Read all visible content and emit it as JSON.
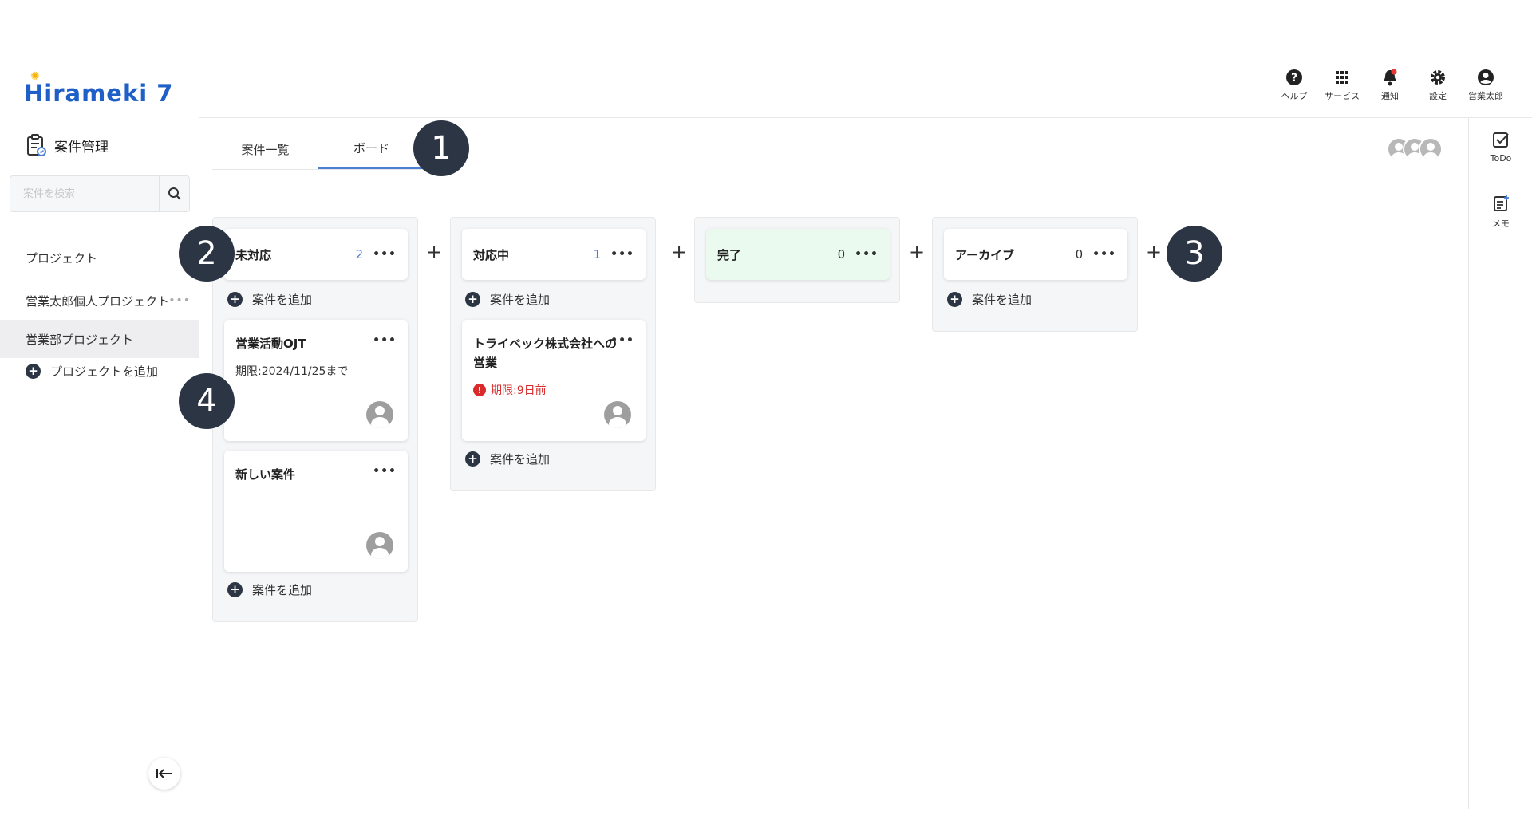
{
  "app": {
    "logo": "Hirameki 7"
  },
  "sidebar": {
    "module_title": "案件管理",
    "search_placeholder": "案件を検索",
    "section_label": "プロジェクト",
    "projects": [
      {
        "label": "営業太郎個人プロジェクト",
        "dots": "•••"
      },
      {
        "label": "営業部プロジェクト"
      }
    ],
    "add_project_label": "プロジェクトを追加"
  },
  "header": {
    "icons": [
      {
        "name": "help-icon",
        "label": "ヘルプ"
      },
      {
        "name": "apps-icon",
        "label": "サービス"
      },
      {
        "name": "bell-icon",
        "label": "通知"
      },
      {
        "name": "gear-icon",
        "label": "設定"
      },
      {
        "name": "user-icon",
        "label": "営業太郎"
      }
    ]
  },
  "rail": {
    "todo_label": "ToDo",
    "memo_label": "メモ"
  },
  "tabs": [
    {
      "label": "案件一覧"
    },
    {
      "label": "ボード"
    }
  ],
  "board": {
    "add_case_label": "案件を追加",
    "dots": "•••",
    "plus": "+",
    "columns": [
      {
        "title": "未対応",
        "count": "2",
        "cards": [
          {
            "title": "営業活動OJT",
            "due": "期限:2024/11/25まで"
          },
          {
            "title": "新しい案件",
            "due": ""
          }
        ]
      },
      {
        "title": "対応中",
        "count": "1",
        "cards": [
          {
            "title": "トライベック株式会社への営業",
            "due": "期限:9日前",
            "overdue": true
          }
        ]
      },
      {
        "title": "完了",
        "count": "0",
        "cards": []
      },
      {
        "title": "アーカイブ",
        "count": "0",
        "cards": []
      }
    ]
  },
  "callouts": [
    "1",
    "2",
    "3",
    "4"
  ],
  "colors": {
    "accent": "#4a7fd4",
    "dark": "#2c3544",
    "done_bg": "#eafaee",
    "overdue": "#d92b2b"
  }
}
